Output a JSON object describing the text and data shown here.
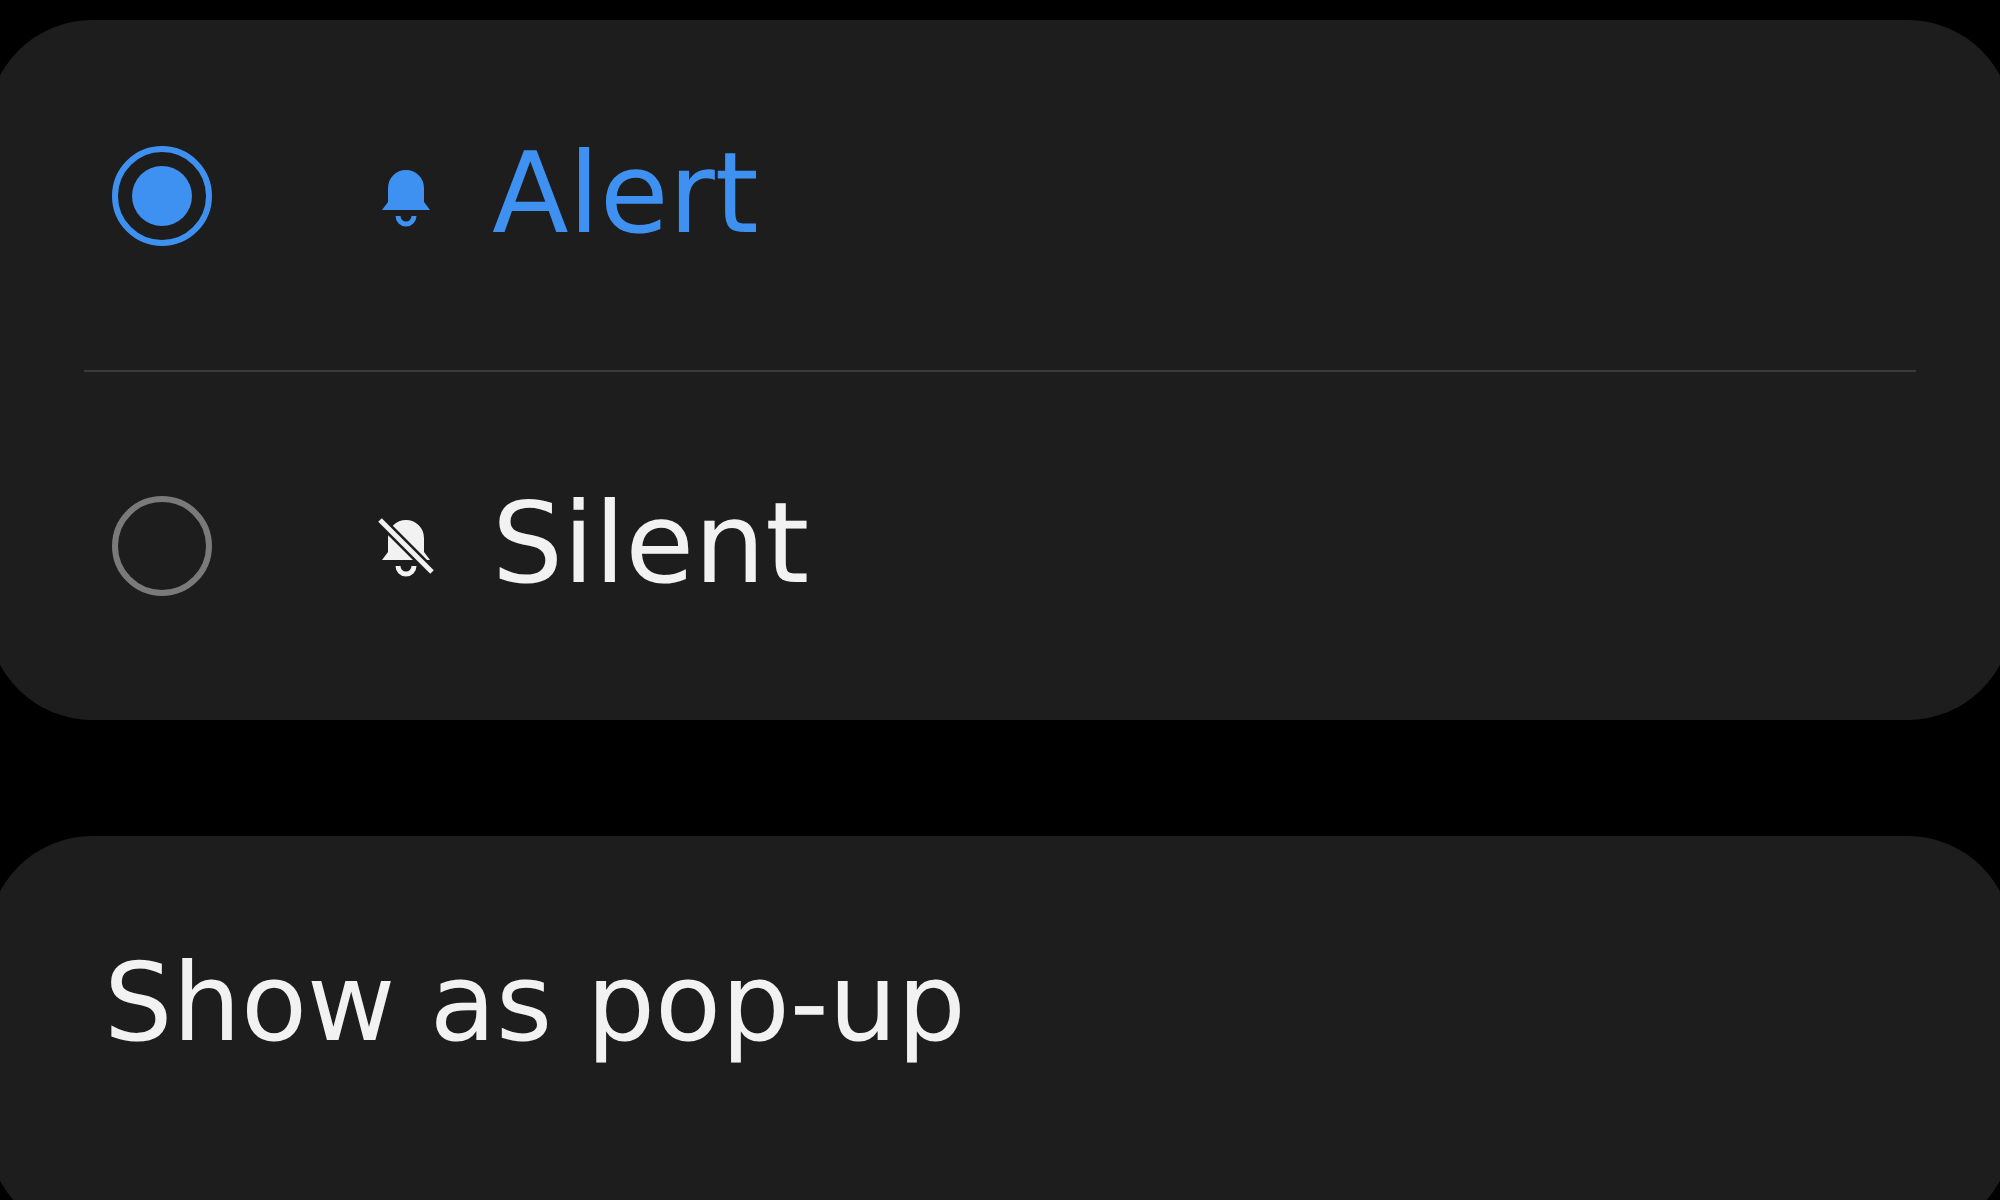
{
  "options": [
    {
      "label": "Alert",
      "kind": "bell",
      "selected": true
    },
    {
      "label": "Silent",
      "kind": "muted",
      "selected": false
    }
  ],
  "popup": {
    "label": "Show as pop-up"
  }
}
